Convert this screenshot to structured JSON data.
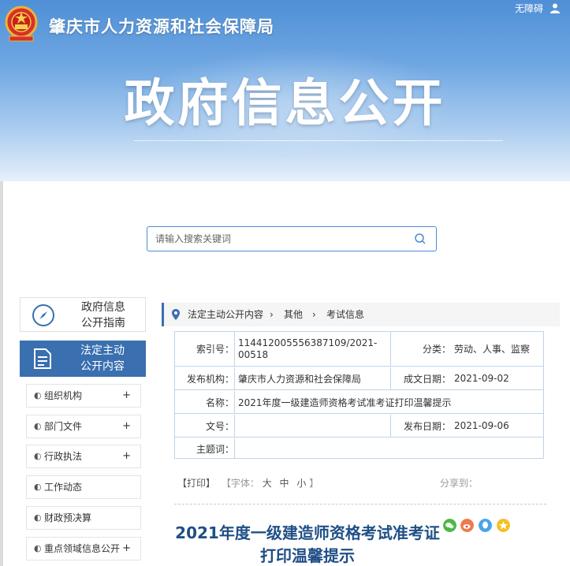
{
  "header": {
    "site_name": "肇庆市人力资源和社会保障局",
    "accessibility": "无障碍",
    "banner_title": "政府信息公开"
  },
  "search": {
    "placeholder": "请输入搜索关键词"
  },
  "sidebar": {
    "guide": {
      "line1": "政府信息",
      "line2": "公开指南"
    },
    "active": {
      "line1": "法定主动",
      "line2": "公开内容"
    },
    "items": [
      {
        "label": "组织机构",
        "expand": "+"
      },
      {
        "label": "部门文件",
        "expand": "+"
      },
      {
        "label": "行政执法",
        "expand": "+"
      },
      {
        "label": "工作动态",
        "expand": ""
      },
      {
        "label": "财政预决算",
        "expand": ""
      },
      {
        "label": "重点领域信息公开",
        "expand": "+"
      }
    ]
  },
  "breadcrumb": {
    "items": [
      "法定主动公开内容",
      "其他",
      "考试信息"
    ],
    "separator": "›"
  },
  "info": {
    "index_label": "索引号：",
    "index_value_1": "114412005556387109/2021-",
    "index_value_2": "00518",
    "category_label": "分类：",
    "category_value": "劳动、人事、监察",
    "publisher_label": "发布机构：",
    "publisher_value": "肇庆市人力资源和社会保障局",
    "created_label": "成文日期：",
    "created_value": "2021-09-02",
    "name_label": "名称：",
    "name_value": "2021年度一级建造师资格考试准考证打印温馨提示",
    "docno_label": "文号：",
    "docno_value": "",
    "published_label": "发布日期：",
    "published_value": "2021-09-06",
    "subject_label": "主题词：",
    "subject_value": ""
  },
  "tools": {
    "print": "【打印】",
    "font_label": "【字体：",
    "font_large": "大",
    "font_medium": "中",
    "font_small": "小",
    "font_end": "】",
    "share_label": "分享到："
  },
  "article": {
    "title": "2021年度一级建造师资格考试准考证打印温馨提示"
  },
  "colors": {
    "primary": "#3a6fb0",
    "title_blue": "#1f4f86",
    "border": "#bfd4ea"
  },
  "icons": [
    "national-emblem-icon",
    "user-icon",
    "search-icon",
    "compass-icon",
    "document-icon",
    "location-pin-icon",
    "wechat-icon",
    "weibo-icon",
    "qq-icon",
    "qzone-icon"
  ]
}
